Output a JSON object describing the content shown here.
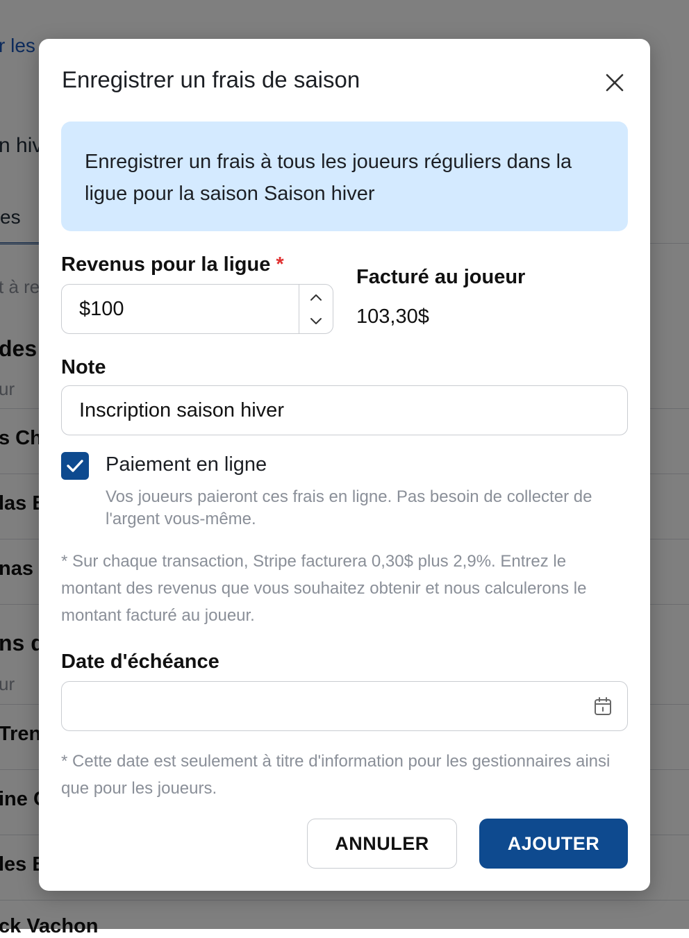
{
  "background": {
    "items": [
      "r les",
      "n hiv",
      "es",
      "t à re",
      "des",
      "ur",
      "s Cha",
      "las B",
      "nas C",
      "ns d",
      "ur",
      "Tren",
      "ine C",
      "les B",
      "ck Vachon"
    ]
  },
  "modal": {
    "title": "Enregistrer un frais de saison",
    "info": "Enregistrer un frais à tous les joueurs réguliers dans la ligue pour la saison Saison hiver",
    "revenue_label": "Revenus pour la ligue",
    "required_mark": "*",
    "revenue_value": "$100",
    "billed_label": "Facturé au joueur",
    "billed_value": "103,30$",
    "note_label": "Note",
    "note_value": "Inscription saison hiver",
    "online_payment_label": "Paiement en ligne",
    "online_payment_checked": true,
    "online_payment_help": "Vos joueurs paieront ces frais en ligne. Pas besoin de collecter de l'argent vous-même.",
    "fee_notice": "* Sur chaque transaction, Stripe facturera 0,30$ plus 2,9%. Entrez le montant des revenus que vous souhaitez obtenir et nous calculerons le montant facturé au joueur.",
    "due_date_label": "Date d'échéance",
    "due_date_value": "",
    "due_date_help": "* Cette date est seulement à titre d'information pour les gestionnaires ainsi que pour les joueurs.",
    "cancel_label": "ANNULER",
    "add_label": "AJOUTER"
  },
  "icons": {
    "close": "close-icon",
    "stepper_up": "chevron-up-icon",
    "stepper_down": "chevron-down-icon",
    "check": "check-icon",
    "calendar": "calendar-icon"
  },
  "colors": {
    "primary": "#0e4a8f",
    "info_bg": "#d4eaff",
    "required": "#e03131",
    "muted_text": "#8a8f98",
    "overlay": "rgba(0,0,0,0.5)"
  }
}
